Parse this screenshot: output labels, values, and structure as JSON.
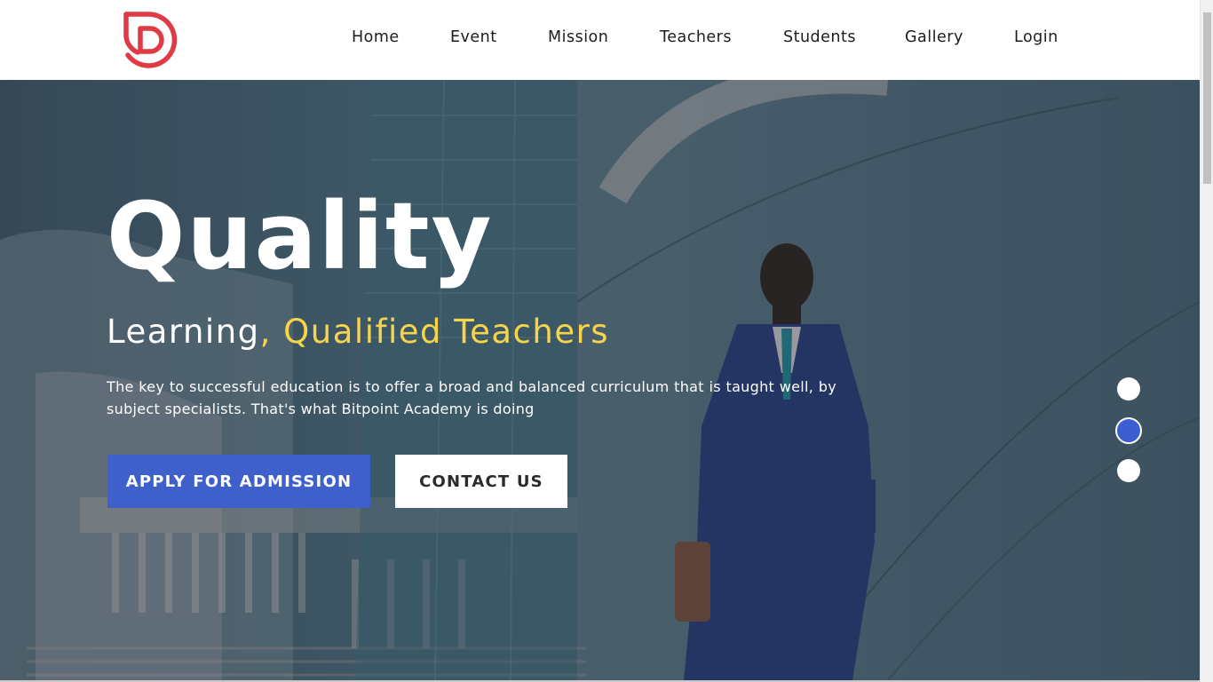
{
  "nav": {
    "logo_icon": "academy-logo-icon",
    "items": [
      {
        "label": "Home"
      },
      {
        "label": "Event"
      },
      {
        "label": "Mission"
      },
      {
        "label": "Teachers"
      },
      {
        "label": "Students"
      },
      {
        "label": "Gallery"
      },
      {
        "label": "Login"
      }
    ]
  },
  "hero": {
    "title": "Quality",
    "subtitle_main": "Learning",
    "subtitle_comma": ",",
    "subtitle_accent": " Qualified Teachers",
    "description": "The key to successful education is to offer a broad and balanced curriculum that is taught well, by subject specialists. That's what Bitpoint Academy is doing",
    "apply_label": "APPLY FOR ADMISSION",
    "contact_label": "CONTACT US",
    "slider": {
      "active_index": 1,
      "total": 3
    }
  },
  "colors": {
    "brand_red": "#e03a45",
    "accent_yellow": "#f7d44b",
    "primary_blue": "#3f5fcb"
  }
}
